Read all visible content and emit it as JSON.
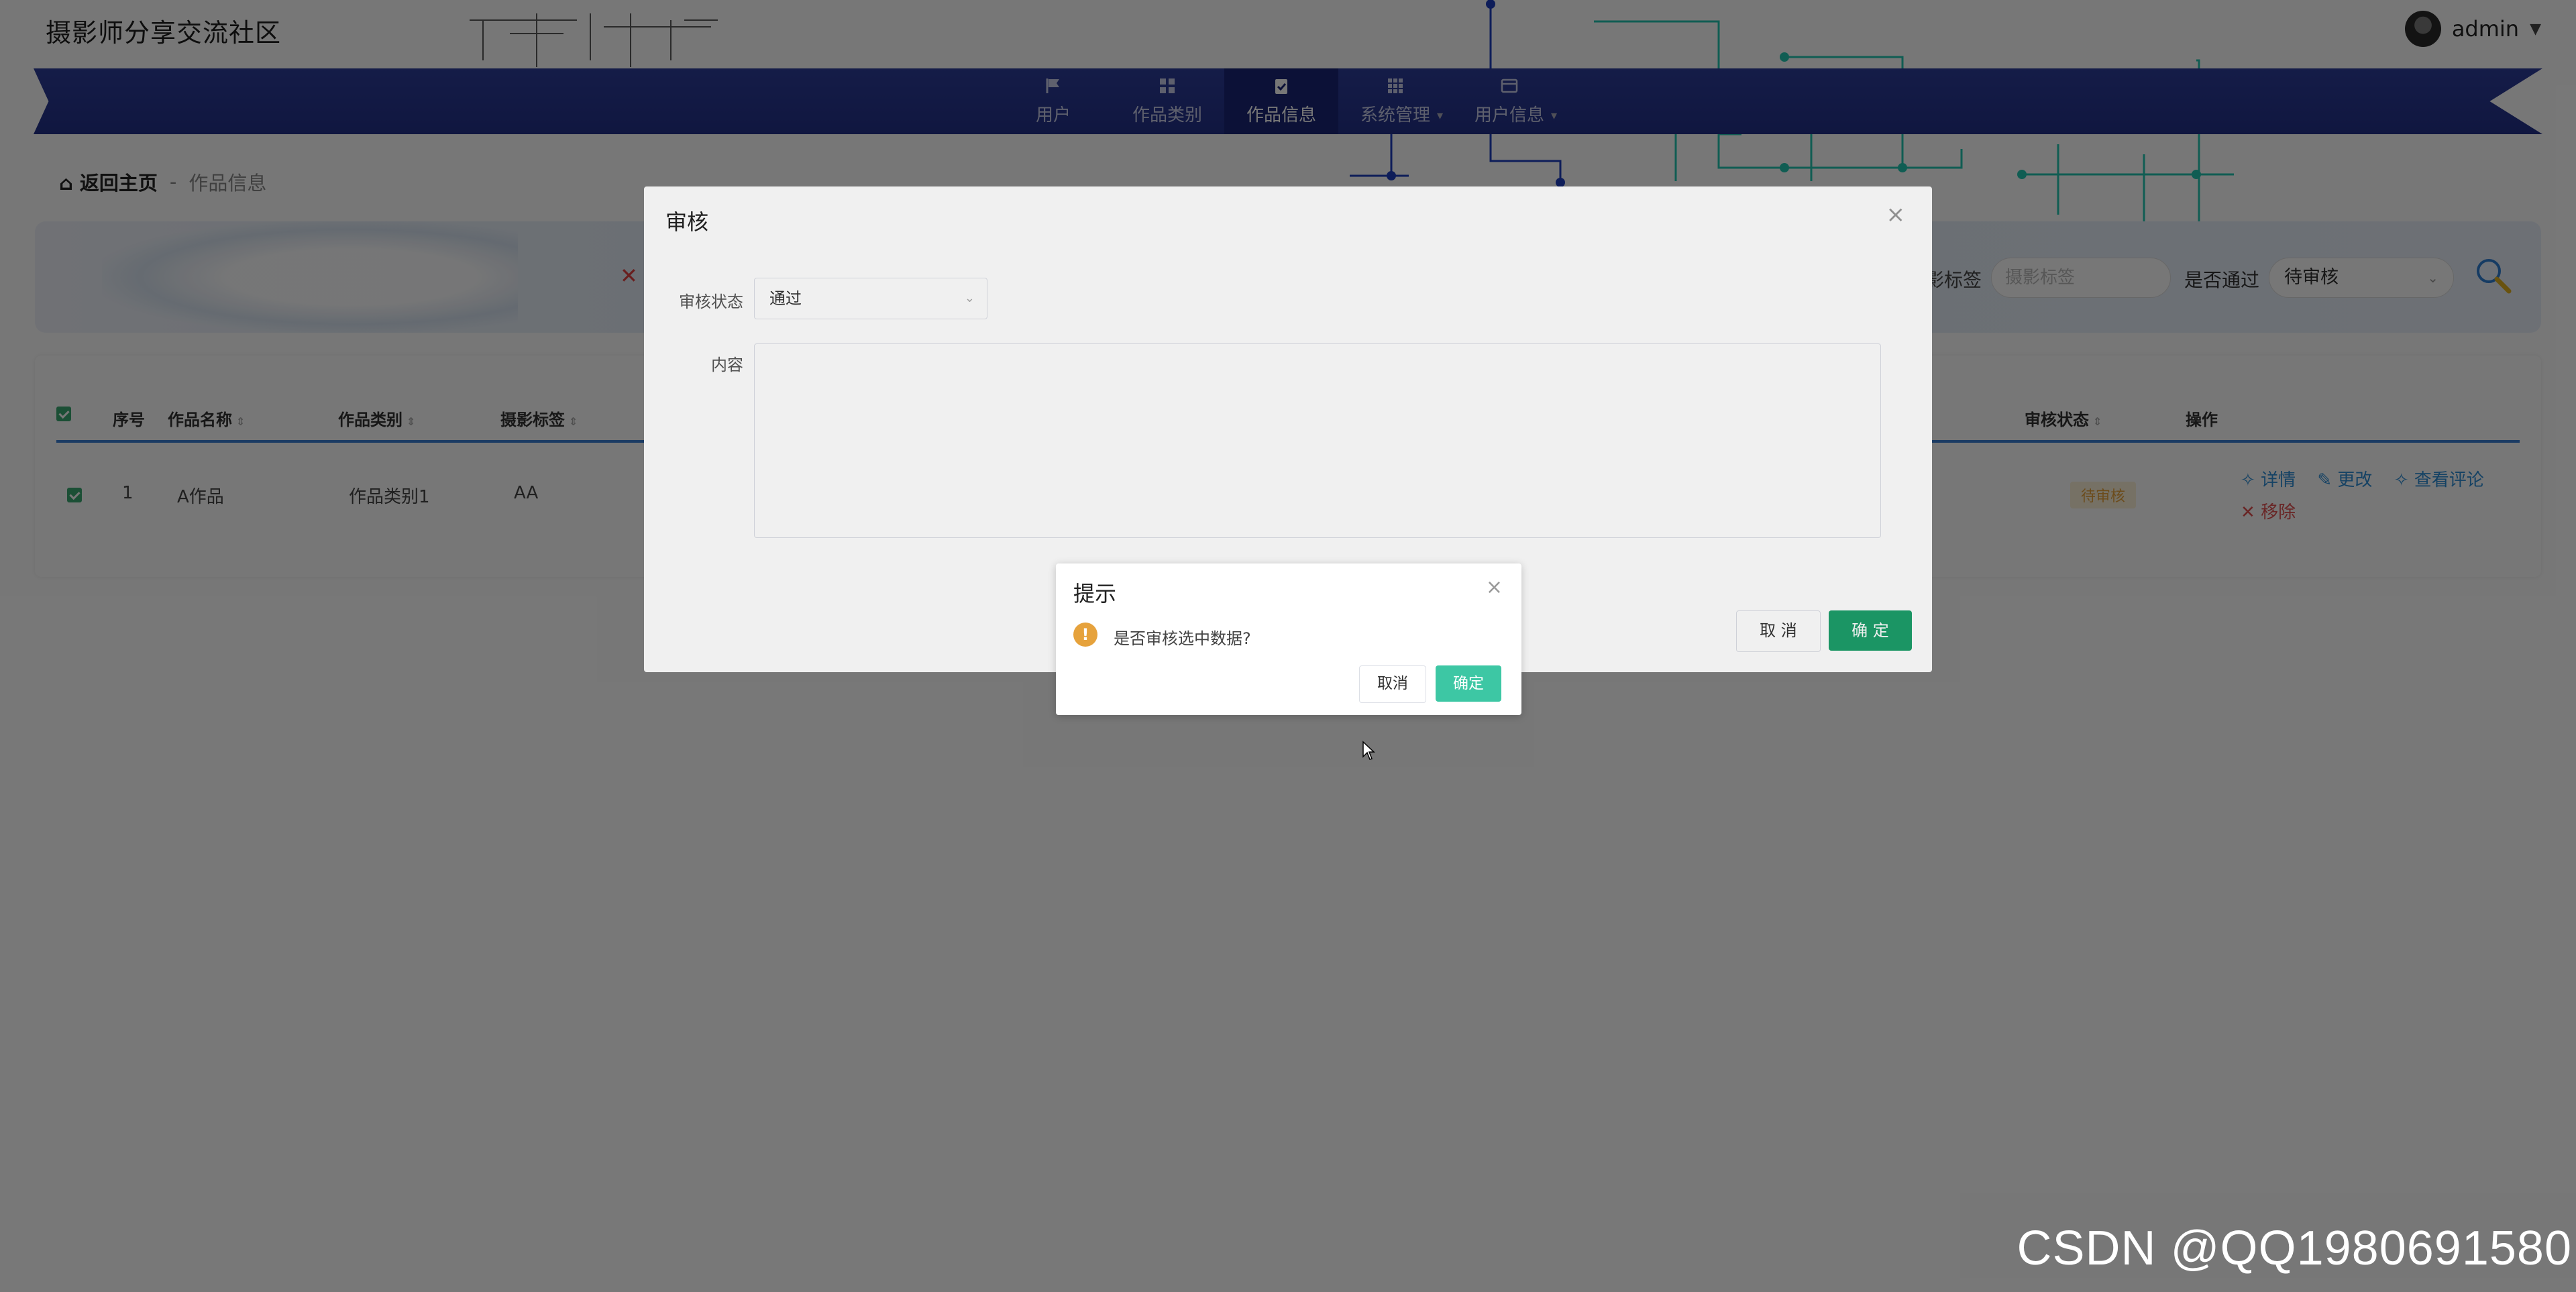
{
  "header": {
    "site_title": "摄影师分享交流社区",
    "username": "admin"
  },
  "nav": {
    "items": [
      {
        "label": "用户",
        "icon": "flag-icon"
      },
      {
        "label": "作品类别",
        "icon": "grid-icon"
      },
      {
        "label": "作品信息",
        "icon": "clipboard-check-icon",
        "active": true
      },
      {
        "label": "系统管理",
        "icon": "apps-icon"
      },
      {
        "label": "用户信息",
        "icon": "card-icon"
      }
    ]
  },
  "breadcrumb": {
    "home": "返回主页",
    "separator": "-",
    "current": "作品信息"
  },
  "search": {
    "tag_label_partial": "影标签",
    "tag_placeholder": "摄影标签",
    "pass_label": "是否通过",
    "pass_value": "待审核"
  },
  "table": {
    "headers": {
      "index": "序号",
      "name": "作品名称",
      "category": "作品类别",
      "tag": "摄影标签",
      "status": "审核状态",
      "actions": "操作"
    },
    "rows": [
      {
        "index": "1",
        "name": "A作品",
        "category": "作品类别1",
        "tag": "AA",
        "status": "待审核",
        "actions": {
          "detail": "详情",
          "edit": "更改",
          "comments": "查看评论",
          "remove": "移除"
        }
      }
    ]
  },
  "review_dialog": {
    "title": "审核",
    "status_label": "审核状态",
    "status_value": "通过",
    "content_label": "内容",
    "cancel": "取 消",
    "confirm": "确 定"
  },
  "confirm_dialog": {
    "title": "提示",
    "message": "是否审核选中数据?",
    "cancel": "取消",
    "confirm": "确定"
  },
  "watermark": "CSDN @QQ1980691580",
  "colors": {
    "navbar": "#2e3d9a",
    "nav_active": "#1b2676",
    "primary_green": "#1d9f6b",
    "confirm_green": "#3dc7a4",
    "warning": "#e6a23c",
    "link_blue": "#2f8fd6",
    "danger": "#e05050",
    "table_underline": "#3a7fd5"
  }
}
